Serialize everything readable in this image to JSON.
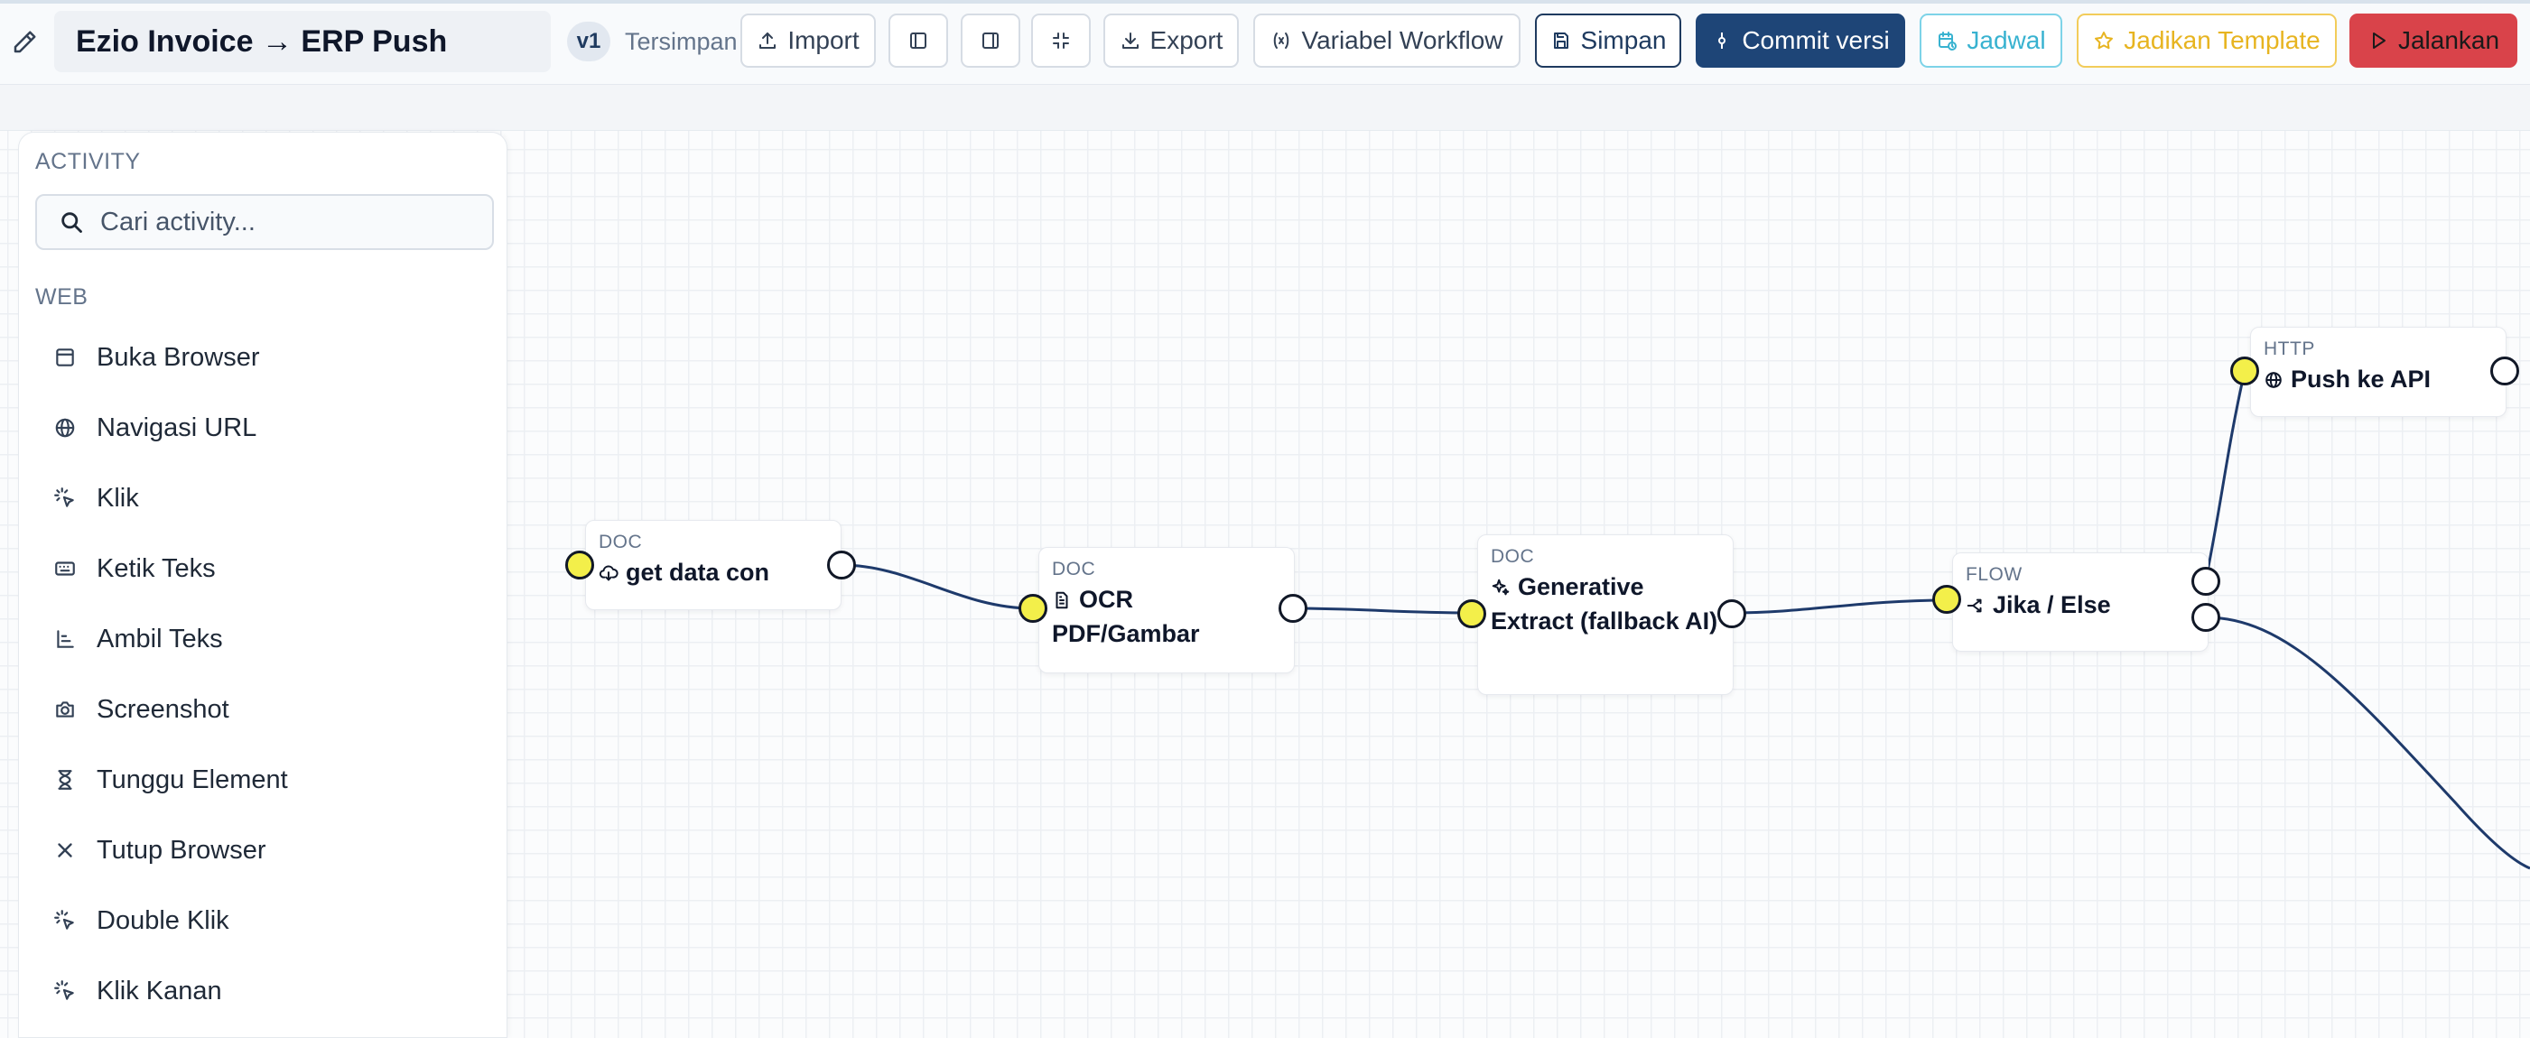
{
  "header": {
    "title": "Ezio Invoice → ERP Push",
    "version": "v1",
    "save_state": "Tersimpan",
    "buttons": {
      "import": "Import",
      "export": "Export",
      "variables": "Variabel Workflow",
      "save": "Simpan",
      "commit": "Commit versi",
      "schedule": "Jadwal",
      "template": "Jadikan Template",
      "run": "Jalankan"
    }
  },
  "sidebar": {
    "heading": "ACTIVITY",
    "search_placeholder": "Cari activity...",
    "group": "WEB",
    "items": [
      {
        "label": "Buka Browser",
        "icon": "browser-icon"
      },
      {
        "label": "Navigasi URL",
        "icon": "globe-icon"
      },
      {
        "label": "Klik",
        "icon": "pointer-click-icon"
      },
      {
        "label": "Ketik Teks",
        "icon": "keyboard-icon"
      },
      {
        "label": "Ambil Teks",
        "icon": "text-align-icon"
      },
      {
        "label": "Screenshot",
        "icon": "camera-icon"
      },
      {
        "label": "Tunggu Element",
        "icon": "hourglass-icon"
      },
      {
        "label": "Tutup Browser",
        "icon": "close-icon"
      },
      {
        "label": "Double Klik",
        "icon": "pointer-click-icon"
      },
      {
        "label": "Klik Kanan",
        "icon": "pointer-click-icon"
      }
    ]
  },
  "nodes": [
    {
      "category": "DOC",
      "name": "get data con",
      "icon": "cloud-download-icon"
    },
    {
      "category": "DOC",
      "name": "OCR PDF/Gambar",
      "icon": "document-icon"
    },
    {
      "category": "DOC",
      "name": "Generative Extract (fallback AI)",
      "icon": "sparkles-icon"
    },
    {
      "category": "FLOW",
      "name": "Jika / Else",
      "icon": "branch-icon"
    },
    {
      "category": "HTTP",
      "name": "Push ke API",
      "icon": "globe-icon"
    }
  ],
  "colors": {
    "primary": "#1e4577",
    "danger": "#d9434a",
    "warning": "#e7b420",
    "info": "#38b2d0",
    "port_input": "#f3ef4a",
    "edge": "#1e3a6b"
  }
}
